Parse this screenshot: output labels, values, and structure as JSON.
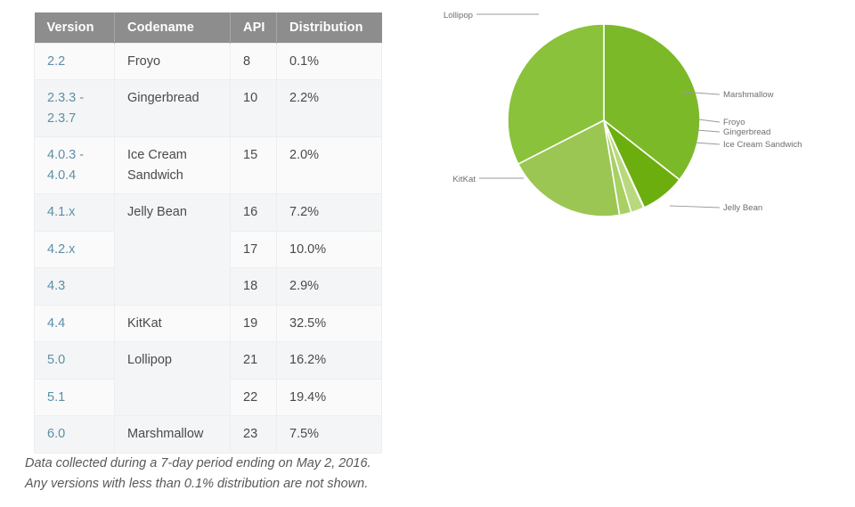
{
  "table": {
    "headers": [
      "Version",
      "Codename",
      "API",
      "Distribution"
    ],
    "rows": [
      {
        "version": "2.2",
        "codename": "Froyo",
        "api": "8",
        "distribution": "0.1%"
      },
      {
        "version": "2.3.3 -\n2.3.7",
        "codename": "Gingerbread",
        "api": "10",
        "distribution": "2.2%"
      },
      {
        "version": "4.0.3 -\n4.0.4",
        "codename": "Ice Cream\nSandwich",
        "api": "15",
        "distribution": "2.0%"
      },
      {
        "version": "4.1.x",
        "codename": "Jelly Bean",
        "api": "16",
        "distribution": "7.2%"
      },
      {
        "version": "4.2.x",
        "codename": "",
        "api": "17",
        "distribution": "10.0%"
      },
      {
        "version": "4.3",
        "codename": "",
        "api": "18",
        "distribution": "2.9%"
      },
      {
        "version": "4.4",
        "codename": "KitKat",
        "api": "19",
        "distribution": "32.5%"
      },
      {
        "version": "5.0",
        "codename": "Lollipop",
        "api": "21",
        "distribution": "16.2%"
      },
      {
        "version": "5.1",
        "codename": "",
        "api": "22",
        "distribution": "19.4%"
      },
      {
        "version": "6.0",
        "codename": "Marshmallow",
        "api": "23",
        "distribution": "7.5%"
      }
    ],
    "header_bg": "#8d8d8d",
    "header_text_color": "#ffffff",
    "version_link_color": "#5c8fa8"
  },
  "footnote": {
    "line1": "Data collected during a 7-day period ending on May 2, 2016.",
    "line2": "Any versions with less than 0.1% distribution are not shown."
  },
  "chart_data": {
    "type": "pie",
    "title": "",
    "legend_position": "callout-labels",
    "grid": false,
    "total": 100.0,
    "start_angle_deg": 0,
    "direction": "clockwise",
    "categories": [
      "Lollipop",
      "Marshmallow",
      "Froyo",
      "Gingerbread",
      "Ice Cream Sandwich",
      "Jelly Bean",
      "KitKat"
    ],
    "values": [
      35.6,
      7.5,
      0.1,
      2.2,
      2.0,
      20.1,
      32.5
    ],
    "colors": [
      "#7cb928",
      "#6dae0f",
      "#cfe3a4",
      "#b9d97e",
      "#a8d063",
      "#9cc653",
      "#8ac23b"
    ],
    "slices": [
      {
        "label": "Lollipop",
        "value": 35.6,
        "color": "#7cb928",
        "note": "5.0 (16.2%) + 5.1 (19.4%)"
      },
      {
        "label": "Marshmallow",
        "value": 7.5,
        "color": "#6dae0f",
        "note": "6.0"
      },
      {
        "label": "Froyo",
        "value": 0.1,
        "color": "#cfe3a4",
        "note": "2.2"
      },
      {
        "label": "Gingerbread",
        "value": 2.2,
        "color": "#b9d97e",
        "note": "2.3.3 - 2.3.7"
      },
      {
        "label": "Ice Cream Sandwich",
        "value": 2.0,
        "color": "#a8d063",
        "note": "4.0.3 - 4.0.4"
      },
      {
        "label": "Jelly Bean",
        "value": 20.1,
        "color": "#9cc653",
        "note": "4.1.x + 4.2.x + 4.3"
      },
      {
        "label": "KitKat",
        "value": 32.5,
        "color": "#8ac23b",
        "note": "4.4"
      }
    ],
    "callouts": [
      {
        "label": "Lollipop",
        "side": "left"
      },
      {
        "label": "Marshmallow",
        "side": "right"
      },
      {
        "label": "Froyo",
        "side": "right"
      },
      {
        "label": "Gingerbread",
        "side": "right"
      },
      {
        "label": "Ice Cream Sandwich",
        "side": "right"
      },
      {
        "label": "Jelly Bean",
        "side": "right"
      },
      {
        "label": "KitKat",
        "side": "left"
      }
    ]
  }
}
